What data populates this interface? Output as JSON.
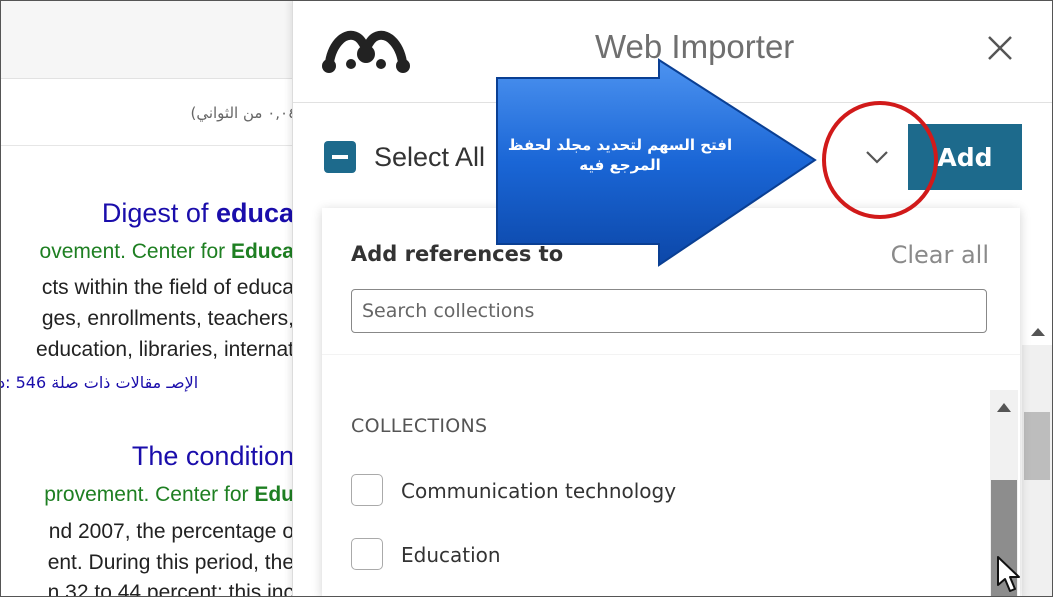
{
  "background_page": {
    "time_text": "(٠,٠٤ من الثواني)",
    "result1": {
      "title_prefix": "Digest of ",
      "title_bold": "educa",
      "source_prefix": "ovement. Center for ",
      "source_bold": "Educa",
      "lines": [
        "cts within the field of educa",
        "ges, enrollments, teachers,",
        "education, libraries, internat"
      ],
      "links": "الإصـ   مقالات ذات صلة   546 :د"
    },
    "result2": {
      "title": "The condition",
      "source_prefix": "provement. Center for ",
      "source_bold": "Edu",
      "lines": [
        "nd 2007, the percentage o",
        "ent. During this period, the",
        "n 32 to 44 percent; this inc"
      ]
    }
  },
  "importer": {
    "title": "Web Importer",
    "select_all_label": "Select All",
    "add_label": "Add",
    "dropdown": {
      "heading": "Add references to",
      "clear_label": "Clear all",
      "search_placeholder": "Search collections",
      "section_label": "COLLECTIONS",
      "items": [
        {
          "label": "Communication technology",
          "checked": false
        },
        {
          "label": "Education",
          "checked": false
        }
      ]
    }
  },
  "annotation": {
    "text": "افتح السهم لتحديد مجلد لحفظ المرجع فيه",
    "arrow_color": "#1a66d6",
    "circle_color": "#d11a1a"
  },
  "colors": {
    "primary": "#1d6a8c",
    "link": "#1a0dab",
    "source_green": "#1e7f22"
  },
  "icons": {
    "logo": "mendeley-logo",
    "close": "close-icon",
    "chevron": "chevron-down-icon",
    "minus_checkbox": "indeterminate-checkbox-icon",
    "cursor": "mouse-cursor-icon"
  }
}
